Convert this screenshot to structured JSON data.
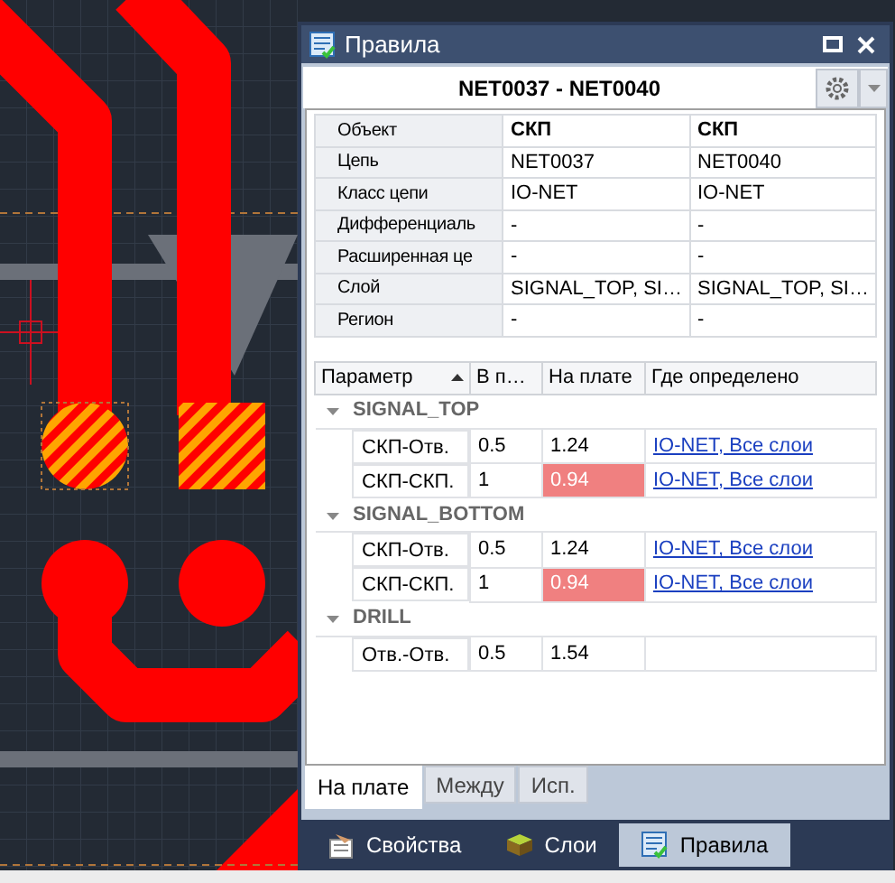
{
  "window": {
    "title": "Правила"
  },
  "header": {
    "title": "NET0037 - NET0040"
  },
  "properties": {
    "rows": [
      {
        "label": "Объект",
        "values": [
          "СКП",
          "СКП"
        ],
        "bold": true
      },
      {
        "label": "Цепь",
        "values": [
          "NET0037",
          "NET0040"
        ],
        "bold": false
      },
      {
        "label": "Класс цепи",
        "values": [
          "IO-NET",
          "IO-NET"
        ],
        "bold": false
      },
      {
        "label": "Дифференциаль",
        "values": [
          "-",
          "-"
        ],
        "bold": false
      },
      {
        "label": "Расширенная це",
        "values": [
          "-",
          "-"
        ],
        "bold": false
      },
      {
        "label": "Слой",
        "values": [
          "SIGNAL_TOP, SI…",
          "SIGNAL_TOP, SI…"
        ],
        "bold": false
      },
      {
        "label": "Регион",
        "values": [
          "-",
          "-"
        ],
        "bold": false
      }
    ]
  },
  "rules": {
    "columns": [
      {
        "label": "Параметр",
        "sorted": true
      },
      {
        "label": "В п…",
        "sorted": false
      },
      {
        "label": "На плате",
        "sorted": false
      },
      {
        "label": "Где определено",
        "sorted": false
      }
    ],
    "groups": [
      {
        "name": "SIGNAL_TOP",
        "expanded": true,
        "rows": [
          {
            "param": "СКП-Отв.",
            "required": "0.5",
            "actual": "1.24",
            "violation": false,
            "source": "IO-NET, Все слои"
          },
          {
            "param": "СКП-СКП.",
            "required": "1",
            "actual": "0.94",
            "violation": true,
            "source": "IO-NET, Все слои"
          }
        ]
      },
      {
        "name": "SIGNAL_BOTTOM",
        "expanded": true,
        "rows": [
          {
            "param": "СКП-Отв.",
            "required": "0.5",
            "actual": "1.24",
            "violation": false,
            "source": "IO-NET, Все слои"
          },
          {
            "param": "СКП-СКП.",
            "required": "1",
            "actual": "0.94",
            "violation": true,
            "source": "IO-NET, Все слои"
          }
        ]
      },
      {
        "name": "DRILL",
        "expanded": true,
        "rows": [
          {
            "param": "Отв.-Отв.",
            "required": "0.5",
            "actual": "1.54",
            "violation": false,
            "source": ""
          }
        ]
      }
    ]
  },
  "tabs": [
    {
      "label": "На плате",
      "selected": true
    },
    {
      "label": "Между",
      "selected": false
    },
    {
      "label": "Исп.",
      "selected": false
    }
  ],
  "bottom_tabs": [
    {
      "label": "Свойства",
      "kind": "properties",
      "selected": false
    },
    {
      "label": "Слои",
      "kind": "layers",
      "selected": false
    },
    {
      "label": "Правила",
      "kind": "rules",
      "selected": true
    }
  ]
}
